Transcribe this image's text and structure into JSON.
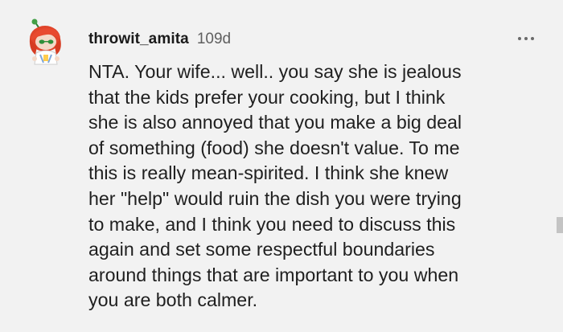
{
  "comment": {
    "username": "throwit_amita",
    "age": "109d",
    "avatar_icon": "snoo-avatar-red-hair-icon",
    "more_icon": "more-options-icon",
    "text": "NTA. Your wife... well.. you say she is jealous\nthat the kids prefer your cooking, but I think\nshe is also annoyed that you make a big deal\nof something (food) she doesn't value. To me\nthis is really mean-spirited. I think she knew\nher \"help\" would ruin the dish you were trying\nto make, and I think you need to discuss this\nagain and set some respectful boundaries\naround things that are important to you when\nyou are both calmer."
  },
  "colors": {
    "background": "#f2f2f2",
    "text": "#1f1f1f",
    "meta": "#5f5f5f",
    "avatar_hair": "#e0452b",
    "avatar_accent": "#4caf50"
  }
}
